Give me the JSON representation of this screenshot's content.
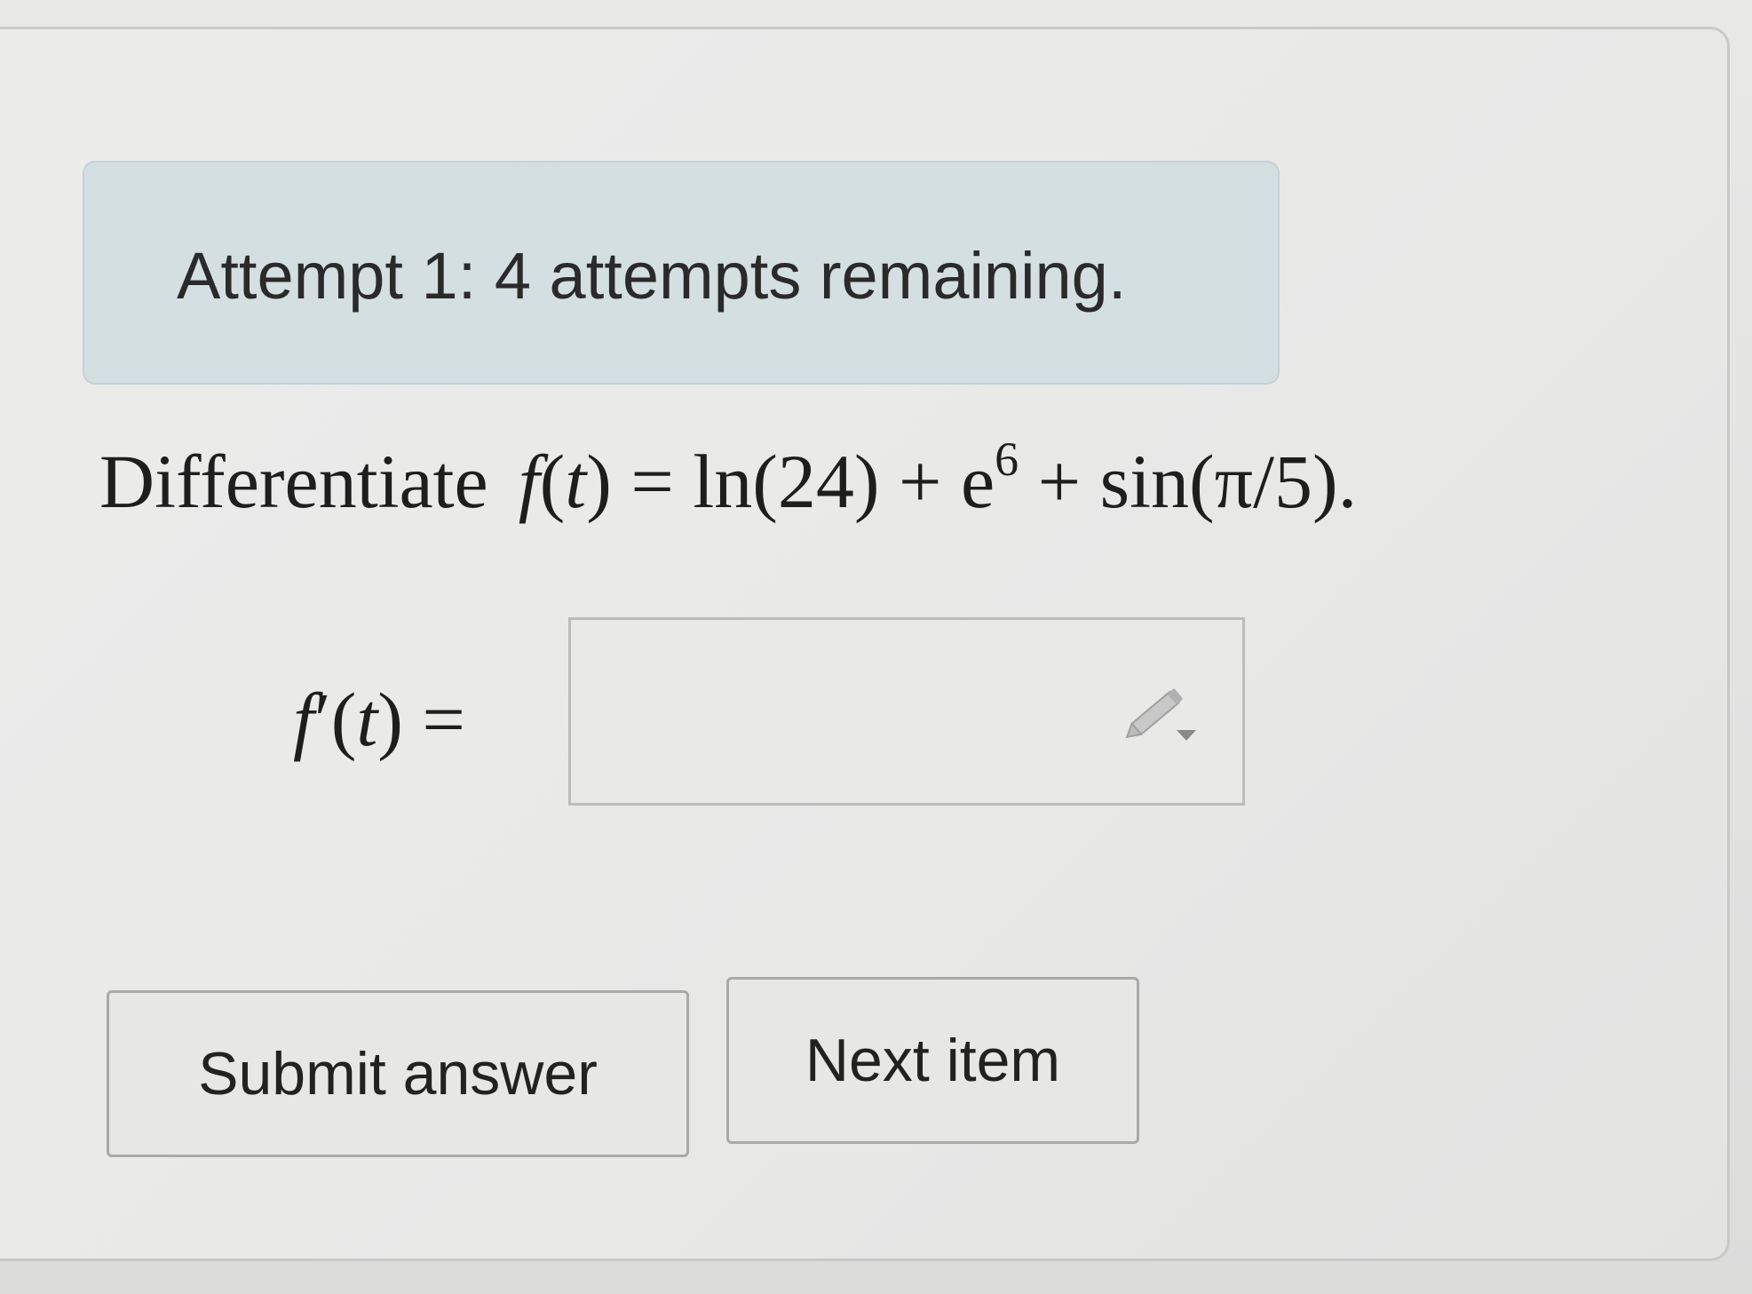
{
  "alert": {
    "text": "Attempt 1: 4 attempts remaining."
  },
  "problem": {
    "instruction": "Differentiate",
    "f": "f",
    "open1": "(",
    "t": "t",
    "close_eq": ") = ln(24) + e",
    "exponent": "6",
    "rest": " + sin(π/5)."
  },
  "answer": {
    "label_f": "f",
    "label_rest": "′(",
    "label_t": "t",
    "label_end": ") =",
    "value": "",
    "editor_icon": "pencil-icon"
  },
  "buttons": {
    "submit_label": "Submit answer",
    "next_label": "Next item"
  },
  "colors": {
    "alert_bg": "#d4dfe2",
    "page_bg": "#e8e8e7",
    "text": "#1e1e1e"
  }
}
